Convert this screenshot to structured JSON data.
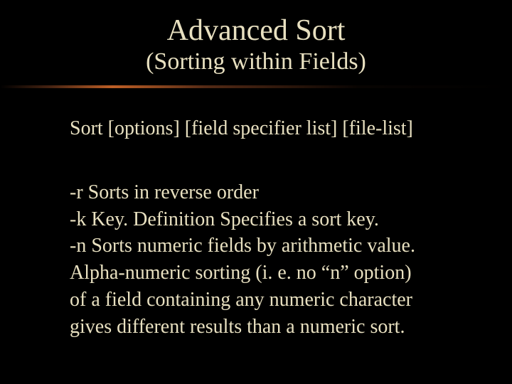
{
  "title": "Advanced Sort",
  "subtitle": "(Sorting within Fields)",
  "syntax": "Sort [options] [field specifier list] [file-list]",
  "options": {
    "r": "-r  Sorts in reverse order",
    "k": "-k Key. Definition Specifies a sort key.",
    "n": "-n Sorts numeric fields by arithmetic value.",
    "note1": "Alpha-numeric sorting (i. e. no “n” option)",
    "note2": "of a field containing any numeric character",
    "note3": "gives different results than a numeric sort."
  }
}
